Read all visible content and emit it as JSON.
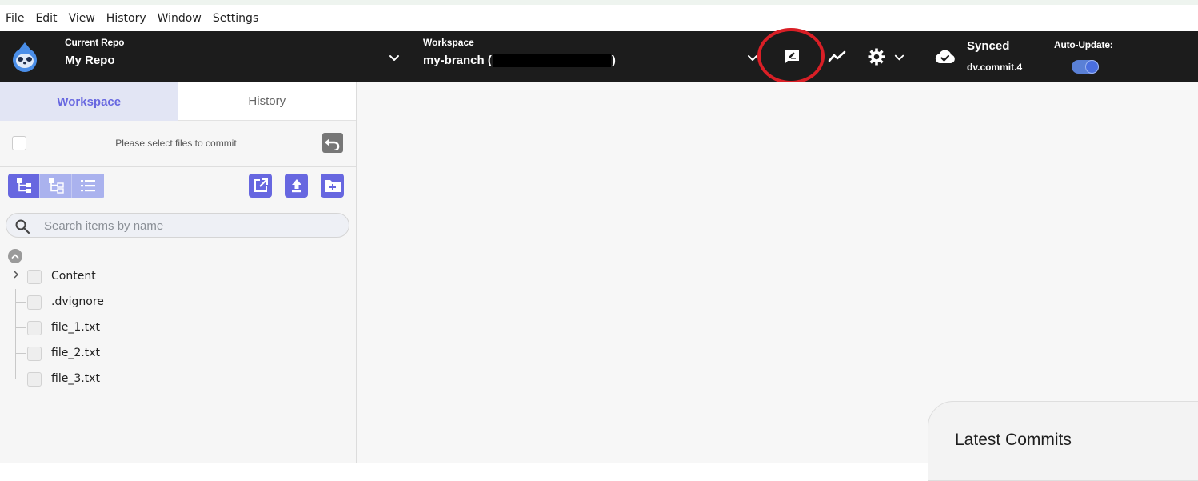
{
  "menubar": {
    "items": [
      "File",
      "Edit",
      "View",
      "History",
      "Window",
      "Settings"
    ]
  },
  "header": {
    "repo_label": "Current Repo",
    "repo_name": "My Repo",
    "workspace_label": "Workspace",
    "workspace_name_prefix": "my-branch (",
    "workspace_name_suffix": ")",
    "sync_status": "Synced",
    "sync_commit": "dv.commit.4",
    "auto_update_label": "Auto-Update:",
    "auto_update_on": true,
    "highlight_color": "#d91f26"
  },
  "sidebar": {
    "tabs": [
      {
        "label": "Workspace",
        "active": true
      },
      {
        "label": "History",
        "active": false
      }
    ],
    "commit_prompt": "Please select files to commit",
    "search_placeholder": "Search items by name",
    "tree": [
      {
        "label": "Content",
        "type": "folder"
      },
      {
        "label": ".dvignore",
        "type": "file"
      },
      {
        "label": "file_1.txt",
        "type": "file"
      },
      {
        "label": "file_2.txt",
        "type": "file"
      },
      {
        "label": "file_3.txt",
        "type": "file"
      }
    ]
  },
  "main": {
    "latest_commits_title": "Latest Commits"
  },
  "colors": {
    "accent": "#6767e0",
    "header_bg": "#1c1c1c"
  }
}
